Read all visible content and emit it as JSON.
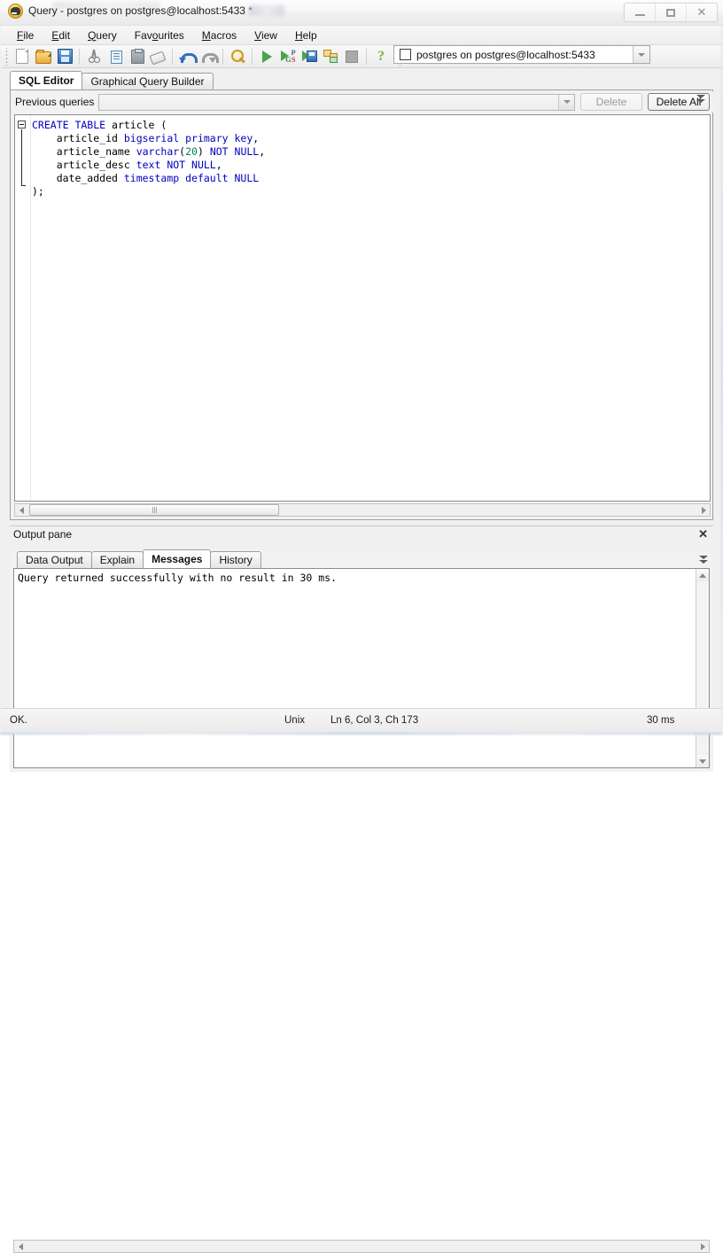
{
  "window": {
    "title": "Query - postgres on postgres@localhost:5433 *",
    "icon": "pgadmin-elephant-icon",
    "controls": {
      "minimize": "minimize-icon",
      "maximize": "maximize-icon",
      "close": "close-icon"
    }
  },
  "menubar": {
    "items": [
      {
        "label": "File",
        "accel": "F"
      },
      {
        "label": "Edit",
        "accel": "E"
      },
      {
        "label": "Query",
        "accel": "Q"
      },
      {
        "label": "Favourites",
        "accel": "o"
      },
      {
        "label": "Macros",
        "accel": "M"
      },
      {
        "label": "View",
        "accel": "V"
      },
      {
        "label": "Help",
        "accel": "H"
      }
    ]
  },
  "toolbar": {
    "buttons": [
      {
        "name": "new-document-icon",
        "tooltip": "New"
      },
      {
        "name": "open-file-icon",
        "tooltip": "Open file"
      },
      {
        "name": "save-icon",
        "tooltip": "Save"
      },
      {
        "name": "cut-icon",
        "tooltip": "Cut"
      },
      {
        "name": "copy-icon",
        "tooltip": "Copy"
      },
      {
        "name": "paste-icon",
        "tooltip": "Paste"
      },
      {
        "name": "clear-window-icon",
        "tooltip": "Clear window"
      },
      {
        "name": "undo-icon",
        "tooltip": "Undo"
      },
      {
        "name": "redo-icon",
        "tooltip": "Redo"
      },
      {
        "name": "find-replace-icon",
        "tooltip": "Find"
      },
      {
        "name": "execute-query-icon",
        "tooltip": "Execute query"
      },
      {
        "name": "execute-pgscript-icon",
        "tooltip": "Execute pgScript"
      },
      {
        "name": "execute-to-file-icon",
        "tooltip": "Execute to file"
      },
      {
        "name": "explain-query-icon",
        "tooltip": "Explain query"
      },
      {
        "name": "stop-icon",
        "tooltip": "Cancel"
      },
      {
        "name": "help-icon",
        "tooltip": "Help"
      }
    ]
  },
  "connection": {
    "value": "postgres on postgres@localhost:5433",
    "checkbox_checked": false,
    "dropdown_icon": "chevron-down-icon"
  },
  "tabs": [
    {
      "label": "SQL Editor",
      "active": true
    },
    {
      "label": "Graphical Query Builder",
      "active": false
    }
  ],
  "previous_queries": {
    "label": "Previous queries",
    "value": "",
    "dropdown_icon": "chevron-down-icon",
    "delete_label": "Delete",
    "delete_enabled": false,
    "delete_all_label": "Delete All",
    "expander_icon": "double-chevron-down-icon"
  },
  "sql_editor": {
    "fold_marker": "collapse-box-icon",
    "lines": [
      [
        {
          "t": "CREATE TABLE",
          "c": "kw"
        },
        {
          "t": " article (",
          "c": ""
        }
      ],
      [
        {
          "t": "    article_id ",
          "c": ""
        },
        {
          "t": "bigserial primary key",
          "c": "kw"
        },
        {
          "t": ",",
          "c": ""
        }
      ],
      [
        {
          "t": "    article_name ",
          "c": ""
        },
        {
          "t": "varchar",
          "c": "kw"
        },
        {
          "t": "(",
          "c": ""
        },
        {
          "t": "20",
          "c": "num"
        },
        {
          "t": ") ",
          "c": ""
        },
        {
          "t": "NOT NULL",
          "c": "kw"
        },
        {
          "t": ",",
          "c": ""
        }
      ],
      [
        {
          "t": "    article_desc ",
          "c": ""
        },
        {
          "t": "text NOT NULL",
          "c": "kw"
        },
        {
          "t": ",",
          "c": ""
        }
      ],
      [
        {
          "t": "    date_added ",
          "c": ""
        },
        {
          "t": "timestamp default NULL",
          "c": "kw"
        }
      ],
      [
        {
          "t": ");",
          "c": ""
        }
      ]
    ],
    "plain_text": "CREATE TABLE article (\n    article_id bigserial primary key,\n    article_name varchar(20) NOT NULL,\n    article_desc text NOT NULL,\n    date_added timestamp default NULL\n);"
  },
  "output_pane": {
    "title": "Output pane",
    "close_icon": "close-icon",
    "expander_icon": "double-chevron-down-icon",
    "tabs": [
      {
        "label": "Data Output",
        "active": false
      },
      {
        "label": "Explain",
        "active": false
      },
      {
        "label": "Messages",
        "active": true
      },
      {
        "label": "History",
        "active": false
      }
    ],
    "message": "Query returned successfully with no result in 30 ms."
  },
  "statusbar": {
    "status": "OK.",
    "line_ending": "Unix",
    "position": "Ln 6, Col 3, Ch 173",
    "duration": "30 ms"
  },
  "colors": {
    "keyword": "#0000c0",
    "number": "#008060",
    "text": "#000000",
    "editor_bg": "#ffffff",
    "chrome_bg": "#f0f0f0"
  }
}
